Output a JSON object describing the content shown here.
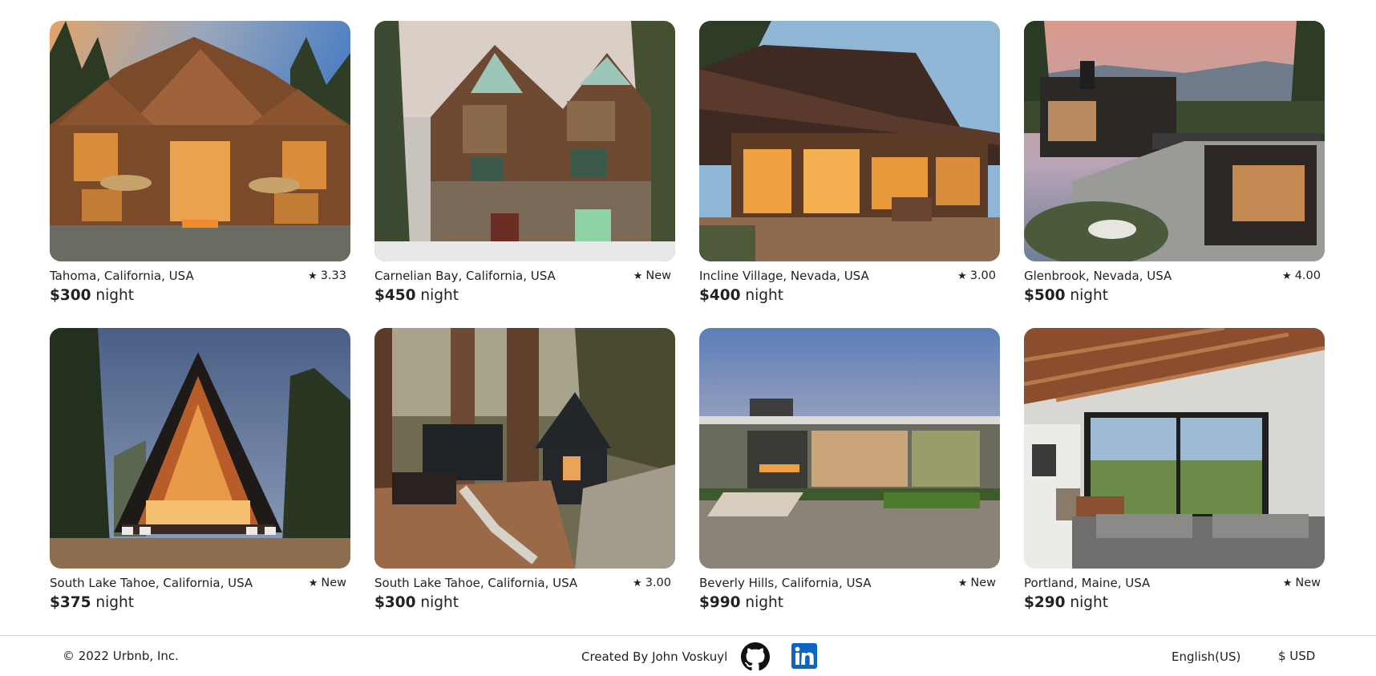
{
  "listings": [
    {
      "location": "Tahoma, California, USA",
      "rating": "3.33",
      "price": "$300",
      "unit": "night",
      "image_icon": "timber-lodge-photo"
    },
    {
      "location": "Carnelian Bay, California, USA",
      "rating": "New",
      "price": "$450",
      "unit": "night",
      "image_icon": "reclaimed-wood-house-photo"
    },
    {
      "location": "Incline Village, Nevada, USA",
      "rating": "3.00",
      "price": "$400",
      "unit": "night",
      "image_icon": "lit-deck-house-photo"
    },
    {
      "location": "Glenbrook, Nevada, USA",
      "rating": "4.00",
      "price": "$500",
      "unit": "night",
      "image_icon": "modern-mountain-house-photo"
    },
    {
      "location": "South Lake Tahoe, California, USA",
      "rating": "New",
      "price": "$375",
      "unit": "night",
      "image_icon": "a-frame-cabin-photo"
    },
    {
      "location": "South Lake Tahoe, California, USA",
      "rating": "3.00",
      "price": "$300",
      "unit": "night",
      "image_icon": "forest-cabin-hammock-photo"
    },
    {
      "location": "Beverly Hills, California, USA",
      "rating": "New",
      "price": "$990",
      "unit": "night",
      "image_icon": "modern-courtyard-house-photo"
    },
    {
      "location": "Portland, Maine, USA",
      "rating": "New",
      "price": "$290",
      "unit": "night",
      "image_icon": "living-room-interior-photo"
    }
  ],
  "footer": {
    "copyright": "© 2022 Urbnb, Inc.",
    "credit": "Created By John Voskuyl",
    "github_icon": "github-icon",
    "linkedin_icon": "linkedin-icon",
    "language": "English(US)",
    "currency": "$ USD"
  },
  "colors": {
    "text": "#222222",
    "linkedin_blue": "#0a66c2",
    "divider": "#cfcfcf"
  }
}
